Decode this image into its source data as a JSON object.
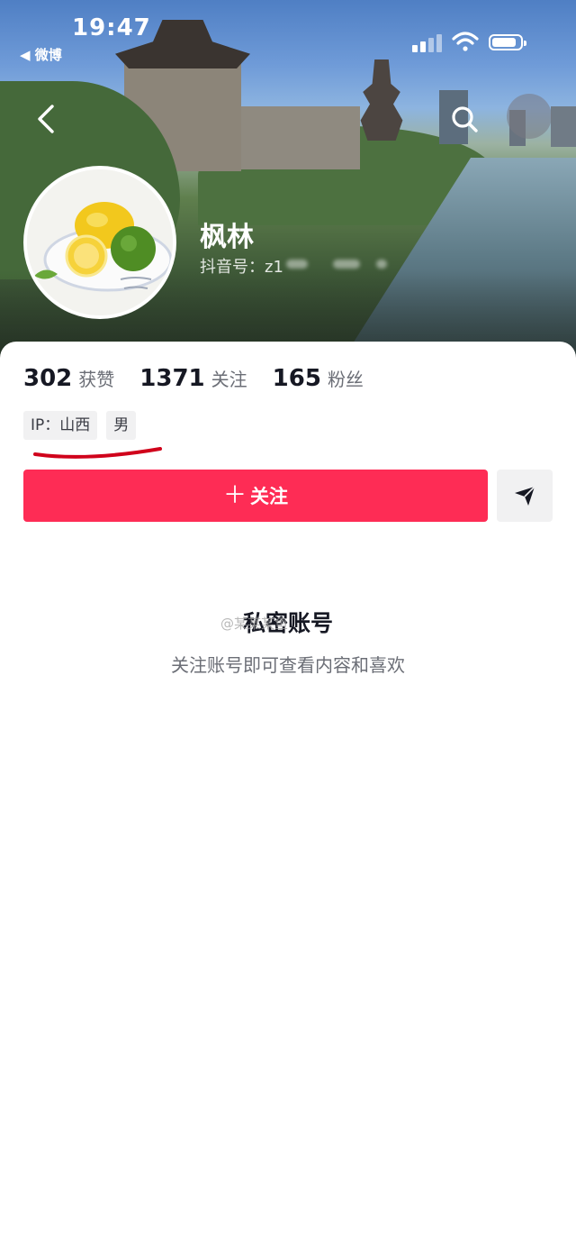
{
  "status_bar": {
    "time": "19:47",
    "back_app": "◀ 微博"
  },
  "header": {
    "back_icon": "chevron-left-icon",
    "search_icon": "search-icon"
  },
  "profile": {
    "nickname": "枫林",
    "douyin_id": "抖音号：z1",
    "avatar": "lemon-lime-photo"
  },
  "stats": [
    {
      "value": "302",
      "label": "获赞"
    },
    {
      "value": "1371",
      "label": "关注"
    },
    {
      "value": "165",
      "label": "粉丝"
    }
  ],
  "tags": {
    "ip": "IP：山西",
    "gender": "男"
  },
  "actions": {
    "follow_plus": "＋",
    "follow_label": "关注",
    "share_icon": "send-icon"
  },
  "private": {
    "title": "私密账号",
    "subtitle": "关注账号即可查看内容和喜欢"
  },
  "watermark": "@某某某鱼",
  "colors": {
    "accent": "#fe2c55",
    "text_primary": "#161823",
    "text_secondary": "#6b6e76",
    "tag_bg": "#f1f1f2",
    "annotation_red": "#d0021b"
  }
}
